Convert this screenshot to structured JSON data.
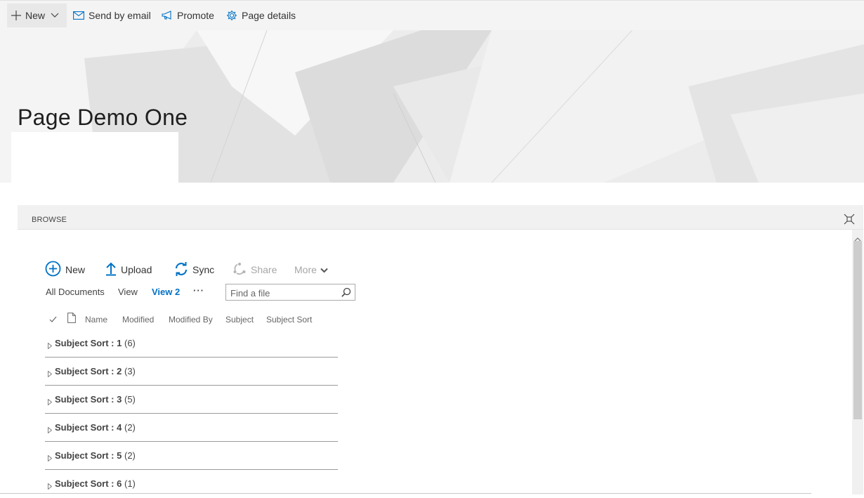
{
  "command_bar": {
    "new_label": "New",
    "email_label": "Send by email",
    "promote_label": "Promote",
    "details_label": "Page details"
  },
  "hero": {
    "title": "Page Demo One"
  },
  "ribbon": {
    "tab_label": "BROWSE"
  },
  "toolbar": {
    "new_label": "New",
    "upload_label": "Upload",
    "sync_label": "Sync",
    "share_label": "Share",
    "more_label": "More"
  },
  "views": {
    "all_documents": "All Documents",
    "view": "View",
    "view2": "View 2",
    "ellipsis": "···"
  },
  "search": {
    "placeholder": "Find a file"
  },
  "columns": {
    "name": "Name",
    "modified": "Modified",
    "modified_by": "Modified By",
    "subject": "Subject",
    "subject_sort": "Subject Sort"
  },
  "groups": [
    {
      "label": "Subject Sort : 1",
      "count": "(6)"
    },
    {
      "label": "Subject Sort : 2",
      "count": "(3)"
    },
    {
      "label": "Subject Sort : 3",
      "count": "(5)"
    },
    {
      "label": "Subject Sort : 4",
      "count": "(2)"
    },
    {
      "label": "Subject Sort : 5",
      "count": "(2)"
    },
    {
      "label": "Subject Sort : 6",
      "count": "(1)"
    }
  ],
  "colors": {
    "accent": "#0072c6",
    "disabled": "#a6a6a6"
  }
}
